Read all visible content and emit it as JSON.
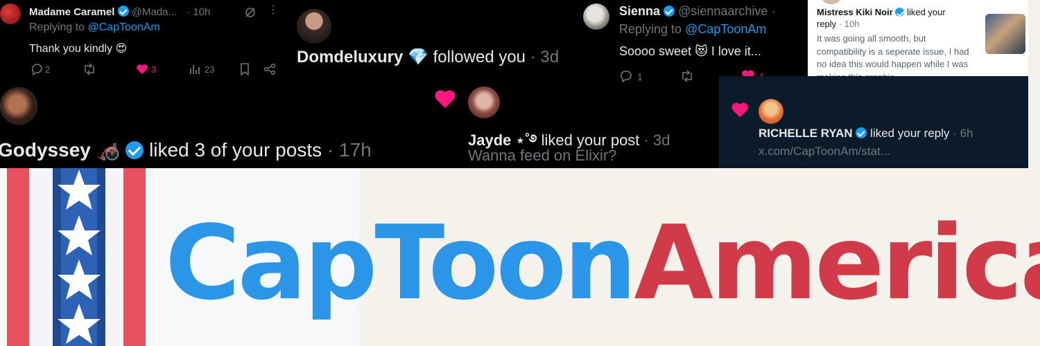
{
  "tweet1": {
    "name": "Madame Caramel",
    "handle": "@Mada...",
    "time": "· 10h",
    "replying_prefix": "Replying to",
    "replying_handle": "@CapToonAm",
    "text": "Thank you kindly",
    "text_emoji": "😍",
    "replies": "2",
    "likes": "3",
    "views": "23"
  },
  "notif_dom": {
    "name": "Domdeluxury",
    "emoji": "💎",
    "action": "followed you",
    "time": "· 3d"
  },
  "tweet_sienna": {
    "name": "Sienna",
    "handle": "@siennaarchive",
    "dot": "·",
    "replying_prefix": "Replying to",
    "replying_handle": "@CapToonAm",
    "text": "Soooo sweet",
    "text_emoji": "😻",
    "text_tail": "I love it...",
    "replies": "1",
    "likes": "1"
  },
  "notif_kiki": {
    "name": "Mistress Kiki Noir",
    "action": "liked your",
    "action2": "reply",
    "time": "· 10h",
    "quote": "It was going all smooth, but compatibility is a seperate issue, I had no idea this would happen while I was making this graphic"
  },
  "notif_godyssey": {
    "name": "Godyssey",
    "emoji": "🦽",
    "action": "liked 3 of your posts",
    "time": "· 17h"
  },
  "notif_jayde": {
    "name": "Jayde ⋆˚࿔",
    "action": "liked your post",
    "time": "· 3d",
    "text": "Wanna feed on Elixir?"
  },
  "notif_richelle": {
    "name": "RICHELLE RYAN",
    "action": "liked your reply",
    "time": "· 6h",
    "link": "x.com/CapToonAm/stat..."
  },
  "brand": {
    "part1": "CapToon",
    "part2": "America",
    "color1": "#2b95e8",
    "color2": "#d03a49"
  },
  "colors": {
    "like": "#f91880",
    "verified": "#1d9bf0",
    "muted": "#71767b"
  }
}
